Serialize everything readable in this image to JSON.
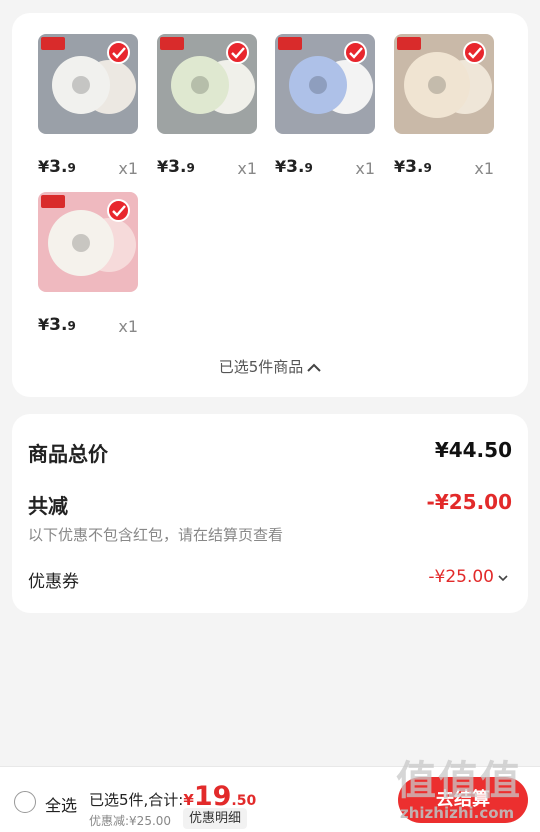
{
  "colors": {
    "accent": "#e8262d",
    "price_red": "#e22a2a",
    "background": "#f4f4f4"
  },
  "items": [
    {
      "price_yen": "¥",
      "price_int": "3.",
      "price_dec": "9",
      "qty": "x1",
      "thumb_bg": "#9aa0a8",
      "bib_color": "#f1f1ee",
      "bib2_color": "#ece8e2"
    },
    {
      "price_yen": "¥",
      "price_int": "3.",
      "price_dec": "9",
      "qty": "x1",
      "thumb_bg": "#9ea3a3",
      "bib_color": "#dfe8d0",
      "bib2_color": "#f0f0ea"
    },
    {
      "price_yen": "¥",
      "price_int": "3.",
      "price_dec": "9",
      "qty": "x1",
      "thumb_bg": "#9ea3ad",
      "bib_color": "#aec1e8",
      "bib2_color": "#f3f3f3"
    },
    {
      "price_yen": "¥",
      "price_int": "3.",
      "price_dec": "9",
      "qty": "x1",
      "thumb_bg": "#c9b9a8",
      "bib_color": "#f0e4d2",
      "bib2_color": "#efe6d8"
    },
    {
      "price_yen": "¥",
      "price_int": "3.",
      "price_dec": "9",
      "qty": "x1",
      "thumb_bg": "#efb9bf",
      "bib_color": "#f5f2ec",
      "bib2_color": "#f6dada"
    }
  ],
  "selected_summary": "已选5件商品",
  "price": {
    "total_label": "商品总价",
    "total_value": "¥44.50",
    "discount_label": "共减",
    "discount_value": "-¥25.00",
    "discount_note": "以下优惠不包含红包，请在结算页查看",
    "coupon_label": "优惠券",
    "coupon_value": "-¥25.00"
  },
  "bottom_bar": {
    "select_all": "全选",
    "sum_text": "已选5件,合计:",
    "sum_yen": "¥",
    "sum_int": "19",
    "sum_dec": ".50",
    "discount_small": "优惠减:¥25.00",
    "detail_button": "优惠明细",
    "checkout_button": "去结算"
  },
  "watermark": {
    "big": "值值值",
    "url": "zhizhizhi.com"
  }
}
